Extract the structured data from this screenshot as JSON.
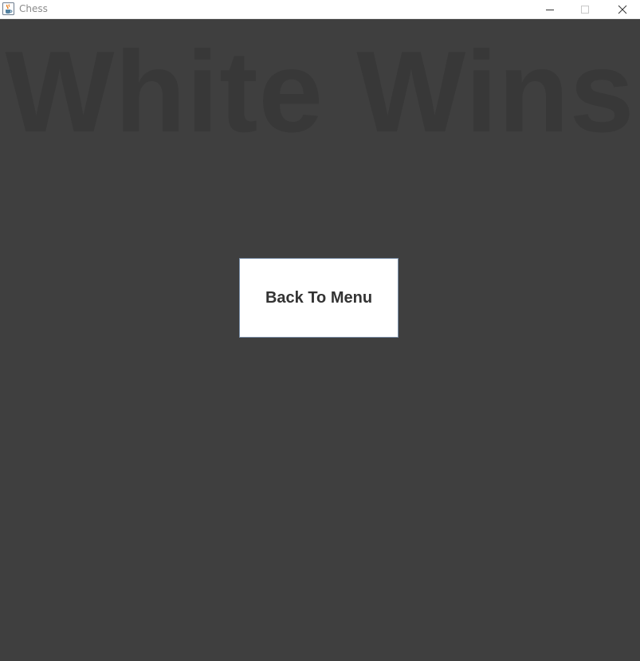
{
  "window": {
    "title": "Chess",
    "app_icon": "java-coffee-cup-icon",
    "controls": [
      "minimize-icon",
      "maximize-icon",
      "close-icon"
    ]
  },
  "game_over": {
    "headline": "White Wins",
    "back_button_label": "Back To Menu"
  },
  "colors": {
    "background": "#3f3f3f",
    "headline_text": "#383838",
    "button_background": "#ffffff",
    "button_text": "#333333"
  }
}
